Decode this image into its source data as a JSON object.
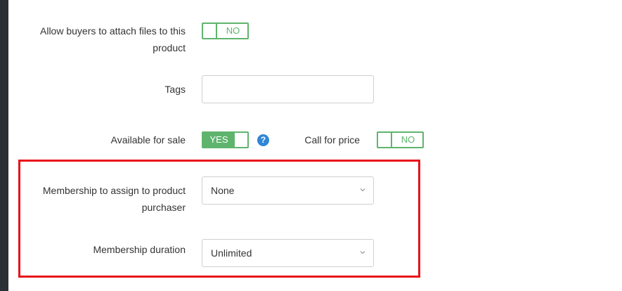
{
  "fields": {
    "attach_files": {
      "label": "Allow buyers to attach files to this product",
      "toggle": "NO"
    },
    "tags": {
      "label": "Tags",
      "value": "",
      "placeholder": ""
    },
    "available_for_sale": {
      "label": "Available for sale",
      "toggle": "YES",
      "help": "?"
    },
    "call_for_price": {
      "label": "Call for price",
      "toggle": "NO"
    },
    "membership": {
      "label": "Membership to assign to product purchaser",
      "value": "None"
    },
    "membership_duration": {
      "label": "Membership duration",
      "value": "Unlimited"
    }
  },
  "colors": {
    "toggle_green": "#5fb46d",
    "highlight_red": "#e8121a",
    "help_blue": "#2f87d6",
    "sidebar": "#2b3035"
  },
  "icons": {
    "help": "question-circle-icon",
    "select_arrow": "chevron-down-icon"
  }
}
